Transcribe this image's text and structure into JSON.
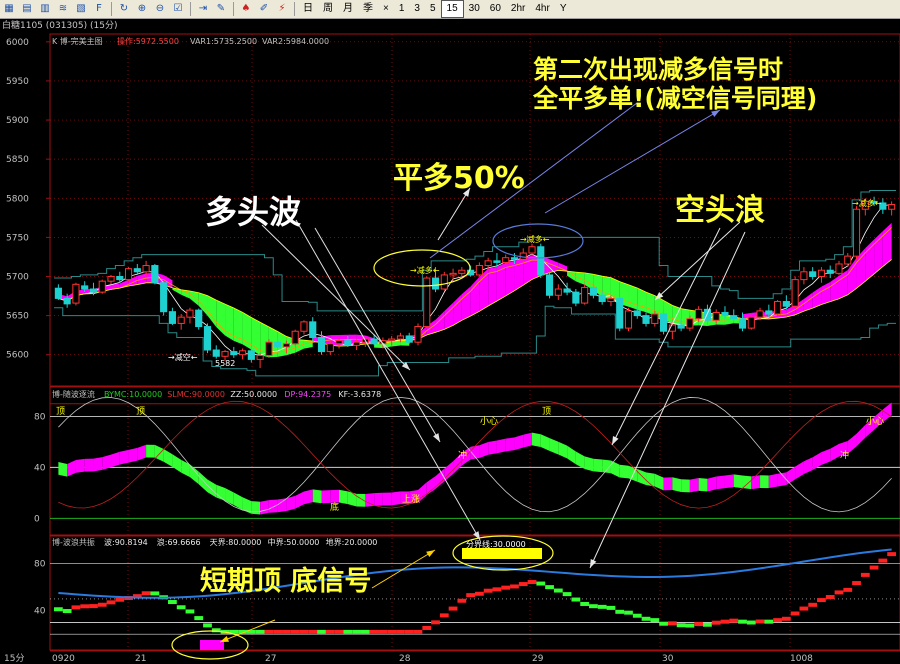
{
  "toolbar": {
    "icons": [
      "grid-icon",
      "table-icon",
      "chart-icon",
      "tick-icon",
      "data-icon",
      "f10-icon",
      "refresh-icon",
      "zoom-in-icon",
      "zoom-out-icon",
      "checkbox-icon",
      "export-icon",
      "edit-icon",
      "alarm-icon",
      "drawing-icon",
      "lightning-icon"
    ],
    "periods": [
      "日",
      "周",
      "月",
      "季",
      "×",
      "1",
      "3",
      "5",
      "15",
      "30",
      "60",
      "2hr",
      "4hr",
      "Y"
    ],
    "active_period": "15"
  },
  "title": "白糖1105 (031305) (15分)",
  "main_panel": {
    "label": "K 博-完美主图",
    "op_label": "操作:5972.5500",
    "var1": "VAR1:5735.2500",
    "var2": "VAR2:5984.0000",
    "yticks": [
      "6000",
      "5950",
      "5900",
      "5850",
      "5800",
      "5750",
      "5700",
      "5650",
      "5600"
    ],
    "low_label": "5582",
    "signals": {
      "short_add": "减空",
      "long_reduce1": "减多",
      "long_reduce2": "减多",
      "long_reduce3": "减多"
    }
  },
  "mid_panel": {
    "label": "博-随波逐流",
    "params": [
      {
        "text": "BYMC:10.0000",
        "color": "#22cc22"
      },
      {
        "text": "SLMC:90.0000",
        "color": "#e03030"
      },
      {
        "text": "ZZ:50.0000",
        "color": "#e8e8e8"
      },
      {
        "text": "DP:94.2375",
        "color": "#ff40ff"
      },
      {
        "text": "KF:-3.6378",
        "color": "#e8e8e8"
      }
    ],
    "yticks": [
      "80",
      "40",
      "0"
    ],
    "markers": {
      "top1": "顶",
      "top2": "顶",
      "top3": "顶",
      "bottom": "底",
      "up": "上涨",
      "mid1": "冲",
      "mid2": "冲",
      "caution1": "小心",
      "caution2": "小心"
    }
  },
  "bot_panel": {
    "label": "博-波浪共振",
    "params": [
      {
        "text": "波:90.8194",
        "color": "#e8e8e8"
      },
      {
        "text": "浪:69.6666",
        "color": "#e8e8e8"
      },
      {
        "text": "天界:80.0000",
        "color": "#e8e8e8"
      },
      {
        "text": "中界:50.0000",
        "color": "#e8e8e8"
      },
      {
        "text": "地界:20.0000",
        "color": "#e8e8e8"
      }
    ],
    "yticks": [
      "80",
      "40"
    ],
    "fenjie": "分界线:30.0000"
  },
  "xaxis": [
    "15分",
    "0920",
    "21",
    "27",
    "28",
    "29",
    "30",
    "1008"
  ],
  "annotations": {
    "note1_line1": "第二次出现减多信号时",
    "note1_line2": "全平多单!(减空信号同理)",
    "half_close": "平多50%",
    "bull_wave": "多头波",
    "bear_wave": "空头浪",
    "short_top_bottom": "短期顶 底信号"
  },
  "chart_data": {
    "type": "candlestick",
    "price_range": [
      5560,
      6010
    ],
    "low_marked": 5582,
    "indicator_range_mid": [
      -10,
      100
    ],
    "indicator_range_bot": [
      10,
      100
    ],
    "candles": [
      [
        5685,
        5690,
        5670,
        5672
      ],
      [
        5672,
        5678,
        5660,
        5665
      ],
      [
        5666,
        5692,
        5663,
        5690
      ],
      [
        5688,
        5694,
        5680,
        5684
      ],
      [
        5684,
        5692,
        5676,
        5680
      ],
      [
        5680,
        5696,
        5678,
        5694
      ],
      [
        5694,
        5702,
        5690,
        5700
      ],
      [
        5700,
        5706,
        5692,
        5696
      ],
      [
        5696,
        5712,
        5694,
        5710
      ],
      [
        5710,
        5716,
        5702,
        5706
      ],
      [
        5706,
        5720,
        5700,
        5714
      ],
      [
        5714,
        5716,
        5690,
        5692
      ],
      [
        5692,
        5694,
        5650,
        5655
      ],
      [
        5655,
        5660,
        5638,
        5640
      ],
      [
        5640,
        5652,
        5632,
        5648
      ],
      [
        5648,
        5660,
        5640,
        5657
      ],
      [
        5657,
        5659,
        5632,
        5636
      ],
      [
        5636,
        5640,
        5602,
        5606
      ],
      [
        5606,
        5612,
        5595,
        5598
      ],
      [
        5598,
        5606,
        5592,
        5604
      ],
      [
        5604,
        5610,
        5596,
        5600
      ],
      [
        5600,
        5608,
        5594,
        5605
      ],
      [
        5605,
        5610,
        5590,
        5594
      ],
      [
        5594,
        5602,
        5583,
        5599
      ],
      [
        5599,
        5620,
        5596,
        5616
      ],
      [
        5616,
        5622,
        5606,
        5610
      ],
      [
        5610,
        5618,
        5602,
        5614
      ],
      [
        5614,
        5632,
        5612,
        5630
      ],
      [
        5630,
        5644,
        5626,
        5642
      ],
      [
        5642,
        5648,
        5618,
        5622
      ],
      [
        5622,
        5630,
        5600,
        5604
      ],
      [
        5604,
        5618,
        5600,
        5614
      ],
      [
        5614,
        5622,
        5608,
        5618
      ],
      [
        5618,
        5624,
        5610,
        5612
      ],
      [
        5612,
        5620,
        5606,
        5616
      ],
      [
        5616,
        5624,
        5610,
        5620
      ],
      [
        5620,
        5626,
        5612,
        5614
      ],
      [
        5614,
        5622,
        5608,
        5618
      ],
      [
        5618,
        5624,
        5612,
        5620
      ],
      [
        5620,
        5628,
        5616,
        5624
      ],
      [
        5624,
        5628,
        5614,
        5616
      ],
      [
        5616,
        5640,
        5612,
        5636
      ],
      [
        5636,
        5700,
        5634,
        5698
      ],
      [
        5698,
        5712,
        5680,
        5684
      ],
      [
        5684,
        5706,
        5682,
        5702
      ],
      [
        5702,
        5710,
        5694,
        5704
      ],
      [
        5704,
        5712,
        5698,
        5708
      ],
      [
        5708,
        5714,
        5700,
        5702
      ],
      [
        5702,
        5718,
        5700,
        5714
      ],
      [
        5714,
        5724,
        5708,
        5720
      ],
      [
        5720,
        5730,
        5712,
        5718
      ],
      [
        5718,
        5728,
        5714,
        5724
      ],
      [
        5724,
        5730,
        5716,
        5722
      ],
      [
        5722,
        5736,
        5718,
        5730
      ],
      [
        5730,
        5742,
        5726,
        5738
      ],
      [
        5738,
        5742,
        5698,
        5702
      ],
      [
        5702,
        5706,
        5672,
        5676
      ],
      [
        5676,
        5690,
        5670,
        5684
      ],
      [
        5684,
        5692,
        5676,
        5680
      ],
      [
        5680,
        5684,
        5662,
        5666
      ],
      [
        5666,
        5690,
        5664,
        5686
      ],
      [
        5686,
        5692,
        5672,
        5676
      ],
      [
        5676,
        5680,
        5664,
        5668
      ],
      [
        5668,
        5676,
        5662,
        5672
      ],
      [
        5672,
        5674,
        5630,
        5634
      ],
      [
        5634,
        5660,
        5630,
        5656
      ],
      [
        5656,
        5664,
        5646,
        5650
      ],
      [
        5650,
        5654,
        5636,
        5640
      ],
      [
        5640,
        5656,
        5636,
        5652
      ],
      [
        5652,
        5658,
        5626,
        5630
      ],
      [
        5630,
        5642,
        5620,
        5638
      ],
      [
        5638,
        5646,
        5630,
        5634
      ],
      [
        5634,
        5650,
        5630,
        5646
      ],
      [
        5646,
        5662,
        5642,
        5658
      ],
      [
        5658,
        5664,
        5640,
        5644
      ],
      [
        5644,
        5658,
        5640,
        5654
      ],
      [
        5654,
        5662,
        5646,
        5650
      ],
      [
        5650,
        5658,
        5642,
        5646
      ],
      [
        5646,
        5654,
        5630,
        5634
      ],
      [
        5634,
        5652,
        5632,
        5648
      ],
      [
        5648,
        5660,
        5644,
        5656
      ],
      [
        5656,
        5664,
        5648,
        5652
      ],
      [
        5652,
        5670,
        5650,
        5668
      ],
      [
        5668,
        5676,
        5658,
        5662
      ],
      [
        5662,
        5700,
        5660,
        5696
      ],
      [
        5696,
        5712,
        5690,
        5706
      ],
      [
        5706,
        5712,
        5696,
        5700
      ],
      [
        5700,
        5712,
        5692,
        5708
      ],
      [
        5708,
        5714,
        5698,
        5704
      ],
      [
        5704,
        5720,
        5702,
        5716
      ],
      [
        5716,
        5730,
        5712,
        5726
      ],
      [
        5726,
        5790,
        5722,
        5786
      ],
      [
        5786,
        5800,
        5778,
        5796
      ],
      [
        5796,
        5802,
        5790,
        5794
      ],
      [
        5794,
        5800,
        5780,
        5786
      ],
      [
        5786,
        5796,
        5778,
        5792
      ]
    ]
  },
  "colors": {
    "bull_band": "#ff00ff",
    "bear_band": "#33ff33",
    "grid_red": "#a01010",
    "channel": "#2a8a8a",
    "annotation_yellow": "#ffff33",
    "up_candle": "#ff3333",
    "down_candle": "#1fd0d0"
  }
}
